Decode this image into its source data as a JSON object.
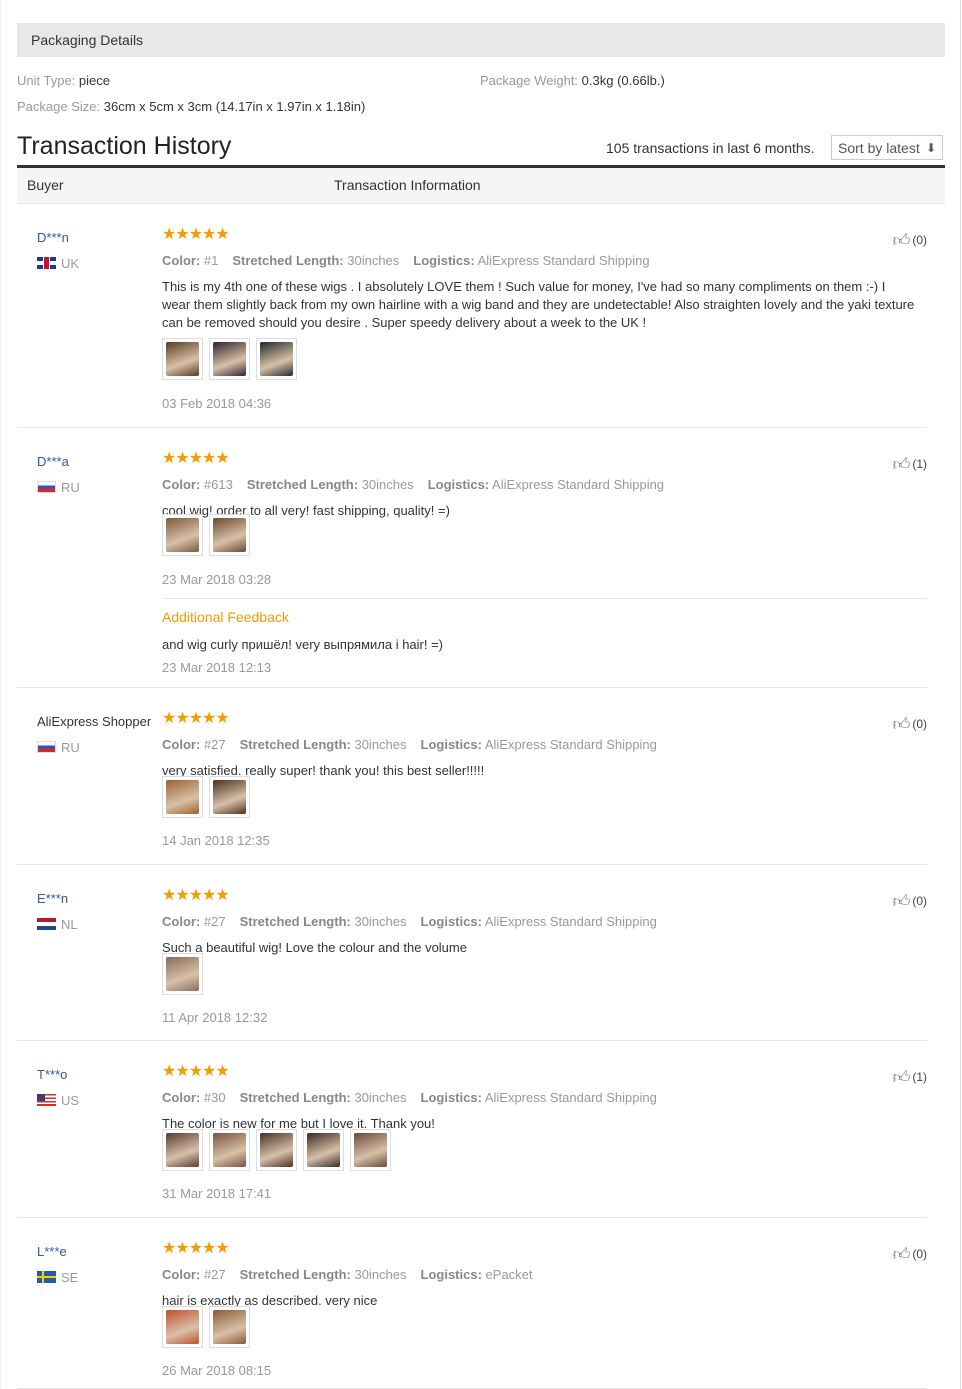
{
  "packaging": {
    "header": "Packaging Details",
    "unit_type_label": "Unit Type:",
    "unit_type_value": "piece",
    "weight_label": "Package Weight:",
    "weight_value": "0.3kg (0.66lb.)",
    "size_label": "Package Size:",
    "size_value": "36cm x 5cm x 3cm (14.17in x 1.97in x 1.18in)"
  },
  "transactions": {
    "title": "Transaction History",
    "count_text": "105 transactions in last 6 months.",
    "sort_label": "Sort by latest",
    "col_buyer": "Buyer",
    "col_info": "Transaction Information"
  },
  "labels": {
    "color": "Color:",
    "length": "Stretched Length:",
    "logistics": "Logistics:",
    "additional": "Additional Feedback"
  },
  "reviews": [
    {
      "buyer": "D***n",
      "country": "UK",
      "flag": "uk",
      "stars": "★★★★★",
      "color": "#1",
      "length": "30inches",
      "logistics": "AliExpress Standard Shipping",
      "text": "This is my 4th one of these wigs . I absolutely LOVE them ! Such value for money, I've had so many compliments on them :-) I wear them slightly back from my own hairline with a wig band and they are undetectable! Also straighten lovely and the yaki texture can be removed should you desire . Super speedy delivery about a week to the UK !",
      "date": "03 Feb 2018 04:36",
      "likes": "(0)",
      "photos": [
        "#5a3a22",
        "#2c2430",
        "#1e2a2a"
      ]
    },
    {
      "buyer": "D***a",
      "country": "RU",
      "flag": "ru",
      "stars": "★★★★★",
      "color": "#613",
      "length": "30inches",
      "logistics": "AliExpress Standard Shipping",
      "text": "cool wig! order to all very! fast shipping, quality! =)",
      "date": "23 Mar 2018 03:28",
      "likes": "(1)",
      "photos": [
        "#7a5a3c",
        "#6a4a30"
      ],
      "additional_text": "and wig curly пришёл! very выпрямила i hair! =)",
      "additional_date": "23 Mar 2018 12:13"
    },
    {
      "buyer": "AliExpress Shopper",
      "country": "RU",
      "flag": "ru",
      "stars": "★★★★★",
      "color": "#27",
      "length": "30inches",
      "logistics": "AliExpress Standard Shipping",
      "text": "very satisfied. really super! thank you! this best seller!!!!!",
      "date": "14 Jan 2018 12:35",
      "likes": "(0)",
      "photos": [
        "#a0602e",
        "#4a3020"
      ]
    },
    {
      "buyer": "E***n",
      "country": "NL",
      "flag": "nl",
      "stars": "★★★★★",
      "color": "#27",
      "length": "30inches",
      "logistics": "AliExpress Standard Shipping",
      "text": "Such a beautiful wig! Love the colour and the volume",
      "date": "11 Apr 2018 12:32",
      "likes": "(0)",
      "photos": [
        "#8a6a5a"
      ]
    },
    {
      "buyer": "T***o",
      "country": "US",
      "flag": "us",
      "stars": "★★★★★",
      "color": "#30",
      "length": "30inches",
      "logistics": "AliExpress Standard Shipping",
      "text": "The color is new for me but I love it. Thank you!",
      "date": "31 Mar 2018 17:41",
      "likes": "(1)",
      "photos": [
        "#5a3a30",
        "#7a5040",
        "#4a3024",
        "#3a2a24",
        "#6a4a34"
      ]
    },
    {
      "buyer": "L***e",
      "country": "SE",
      "flag": "se",
      "stars": "★★★★★",
      "color": "#27",
      "length": "30inches",
      "logistics": "ePacket",
      "text": "hair is exactly as described. very nice",
      "date": "26 Mar 2018 08:15",
      "likes": "(0)",
      "photos": [
        "#c0502a",
        "#8a5a34"
      ]
    }
  ]
}
